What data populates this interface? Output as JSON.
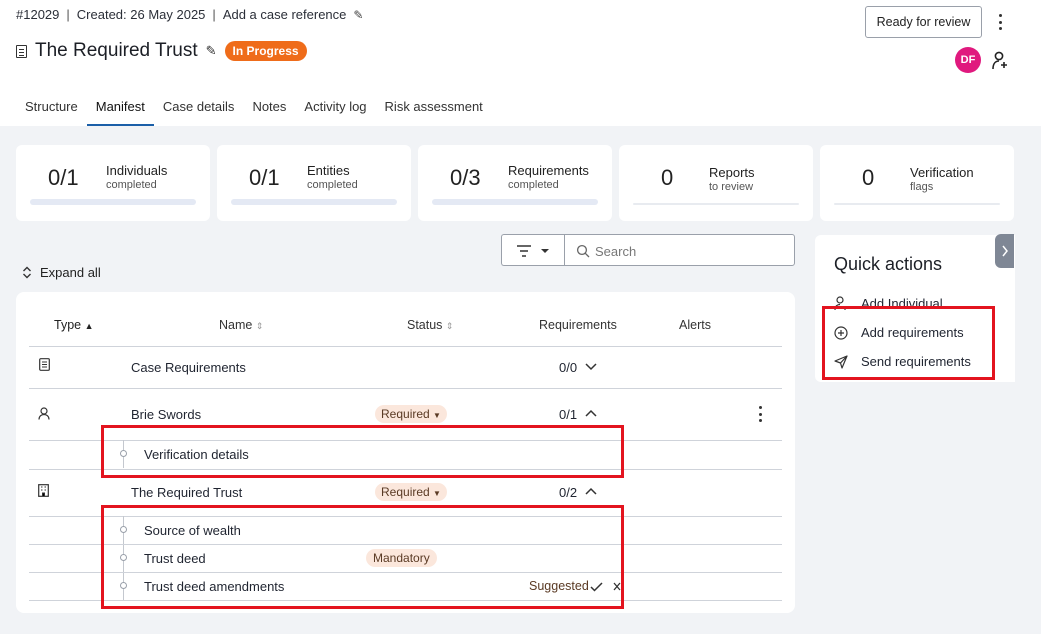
{
  "case": {
    "id": "#12029",
    "created": "Created: 26 May 2025",
    "reference_link": "Add a case reference",
    "title": "The Required Trust",
    "status": "In Progress"
  },
  "header_actions": {
    "ready_label": "Ready for review",
    "avatar_initials": "DF"
  },
  "tabs": [
    {
      "label": "Structure"
    },
    {
      "label": "Manifest",
      "active": true
    },
    {
      "label": "Case details"
    },
    {
      "label": "Notes"
    },
    {
      "label": "Activity log"
    },
    {
      "label": "Risk assessment"
    }
  ],
  "stats": [
    {
      "value": "0/1",
      "label": "Individuals",
      "sub": "completed"
    },
    {
      "value": "0/1",
      "label": "Entities",
      "sub": "completed"
    },
    {
      "value": "0/3",
      "label": "Requirements",
      "sub": "completed"
    },
    {
      "value": "0",
      "label": "Reports",
      "sub": "to review"
    },
    {
      "value": "0",
      "label": "Verification",
      "sub": "flags"
    }
  ],
  "search": {
    "placeholder": "Search"
  },
  "expand_all_label": "Expand all",
  "table": {
    "headers": {
      "type": "Type",
      "name": "Name",
      "status": "Status",
      "requirements": "Requirements",
      "alerts": "Alerts"
    },
    "rows": [
      {
        "icon": "document-icon",
        "name": "Case Requirements",
        "status": "",
        "requirements": "0/0"
      },
      {
        "icon": "person-icon",
        "name": "Brie Swords",
        "status": "Required",
        "requirements": "0/1",
        "children": [
          {
            "name": "Verification details"
          }
        ]
      },
      {
        "icon": "building-icon",
        "name": "The Required Trust",
        "status": "Required",
        "requirements": "0/2",
        "children": [
          {
            "name": "Source of wealth"
          },
          {
            "name": "Trust deed",
            "tag": "Mandatory"
          },
          {
            "name": "Trust deed amendments",
            "suggested": "Suggested"
          }
        ]
      }
    ]
  },
  "quick_actions": {
    "title": "Quick actions",
    "items": [
      {
        "label": "Add Individual",
        "icon": "person-add-icon"
      },
      {
        "label": "Add requirements",
        "icon": "plus-circle-icon"
      },
      {
        "label": "Send requirements",
        "icon": "send-icon"
      }
    ]
  },
  "colors": {
    "status_in_progress": "#ef6c1a",
    "avatar": "#e0197e",
    "tab_active": "#1b5fa8",
    "highlight": "#e3141f",
    "tag_bg": "#fbe7dc"
  }
}
